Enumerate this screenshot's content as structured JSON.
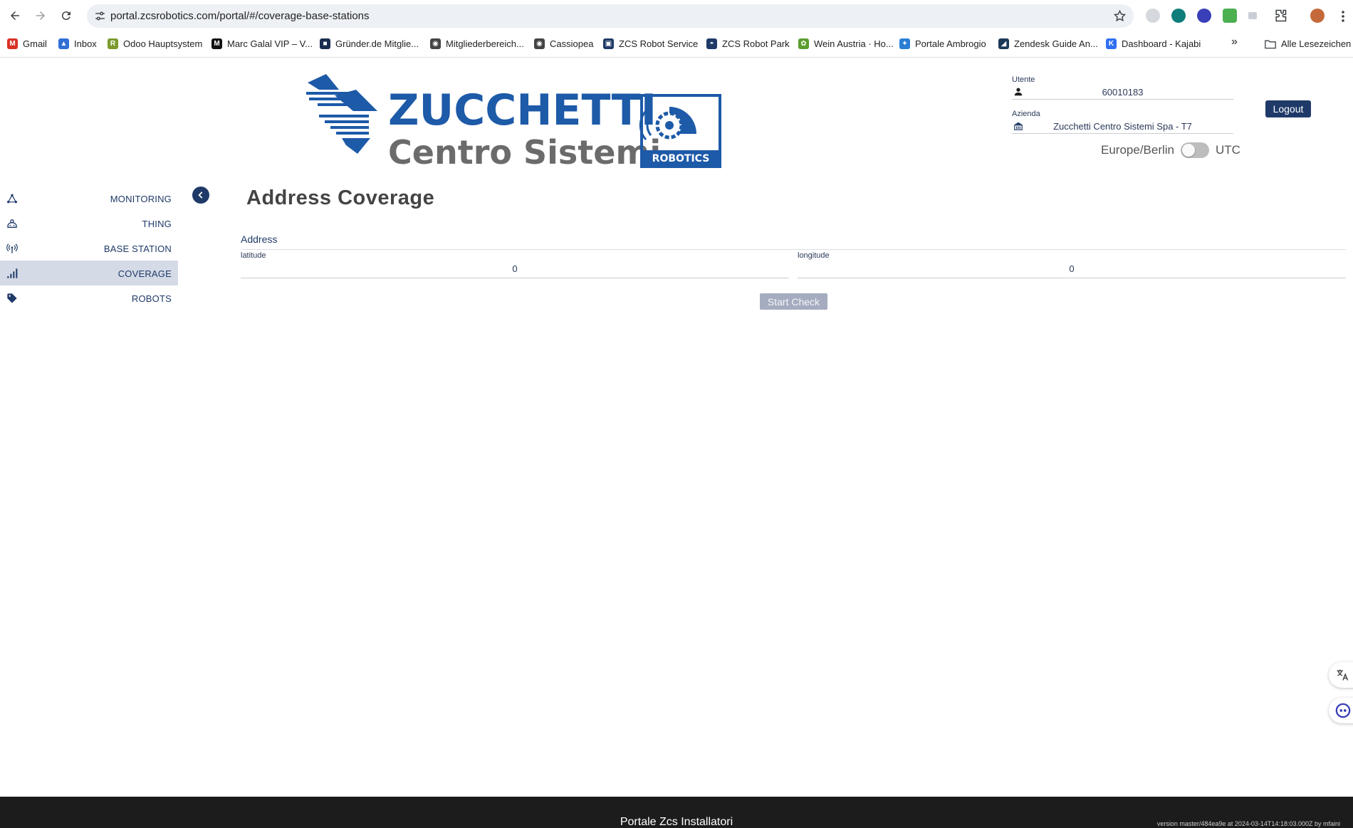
{
  "browser": {
    "url": "portal.zcsrobotics.com/portal/#/coverage-base-stations",
    "bookmarks": [
      {
        "label": "Gmail",
        "color": "#d93025",
        "glyph": "M"
      },
      {
        "label": "Inbox",
        "color": "#2f6fd6",
        "glyph": "▲"
      },
      {
        "label": "Odoo Hauptsystem",
        "color": "#7c9a2d",
        "glyph": "R"
      },
      {
        "label": "Marc Galal VIP – V...",
        "color": "#111111",
        "glyph": "M"
      },
      {
        "label": "Gründer.de Mitglie...",
        "color": "#1b2d4f",
        "glyph": "■"
      },
      {
        "label": "Mitgliederbereich...",
        "color": "#444444",
        "glyph": "◉"
      },
      {
        "label": "Cassiopea",
        "color": "#444444",
        "glyph": "◉"
      },
      {
        "label": "ZCS Robot Service",
        "color": "#1f3a68",
        "glyph": "▣"
      },
      {
        "label": "ZCS Robot Park",
        "color": "#1f3a68",
        "glyph": "◓"
      },
      {
        "label": "Wein Austria · Ho...",
        "color": "#5a9e2f",
        "glyph": "✿"
      },
      {
        "label": "Portale Ambrogio",
        "color": "#2a7fd4",
        "glyph": "✦"
      },
      {
        "label": "Zendesk Guide An...",
        "color": "#1b3a57",
        "glyph": "◢"
      },
      {
        "label": "Dashboard - Kajabi",
        "color": "#2e6ff2",
        "glyph": "K"
      }
    ],
    "more_label": "»",
    "other_bookmarks": "Alle Lesezeichen"
  },
  "header": {
    "logo_word1": "ZUCCHETTI",
    "logo_word2": "Centro Sistemi",
    "logo_badge": "ROBOTICS",
    "user_label": "Utente",
    "user_value": "60010183",
    "company_label": "Azienda",
    "company_value": "Zucchetti Centro Sistemi Spa - T7",
    "timezone": "Europe/Berlin",
    "utc_label": "UTC",
    "logout_label": "Logout"
  },
  "sidebar": {
    "items": [
      {
        "label": "MONITORING",
        "icon": "network-icon"
      },
      {
        "label": "THING",
        "icon": "robot-icon"
      },
      {
        "label": "BASE STATION",
        "icon": "antenna-icon"
      },
      {
        "label": "COVERAGE",
        "icon": "signal-bars-icon",
        "active": true
      },
      {
        "label": "ROBOTS",
        "icon": "tag-icon"
      }
    ]
  },
  "main": {
    "title": "Address Coverage",
    "address_label": "Address",
    "latitude_label": "latitude",
    "latitude_value": "0",
    "longitude_label": "longitude",
    "longitude_value": "0",
    "start_label": "Start Check"
  },
  "footer": {
    "title": "Portale Zcs Installatori",
    "version": "version master/484ea9e at 2024-03-14T14:18:03.000Z by mfaini"
  },
  "colors": {
    "brand_navy": "#1f3a68",
    "logo_blue": "#1d5aa8",
    "logo_grey": "#6b6b6b",
    "active_bg": "#d4dae6"
  }
}
